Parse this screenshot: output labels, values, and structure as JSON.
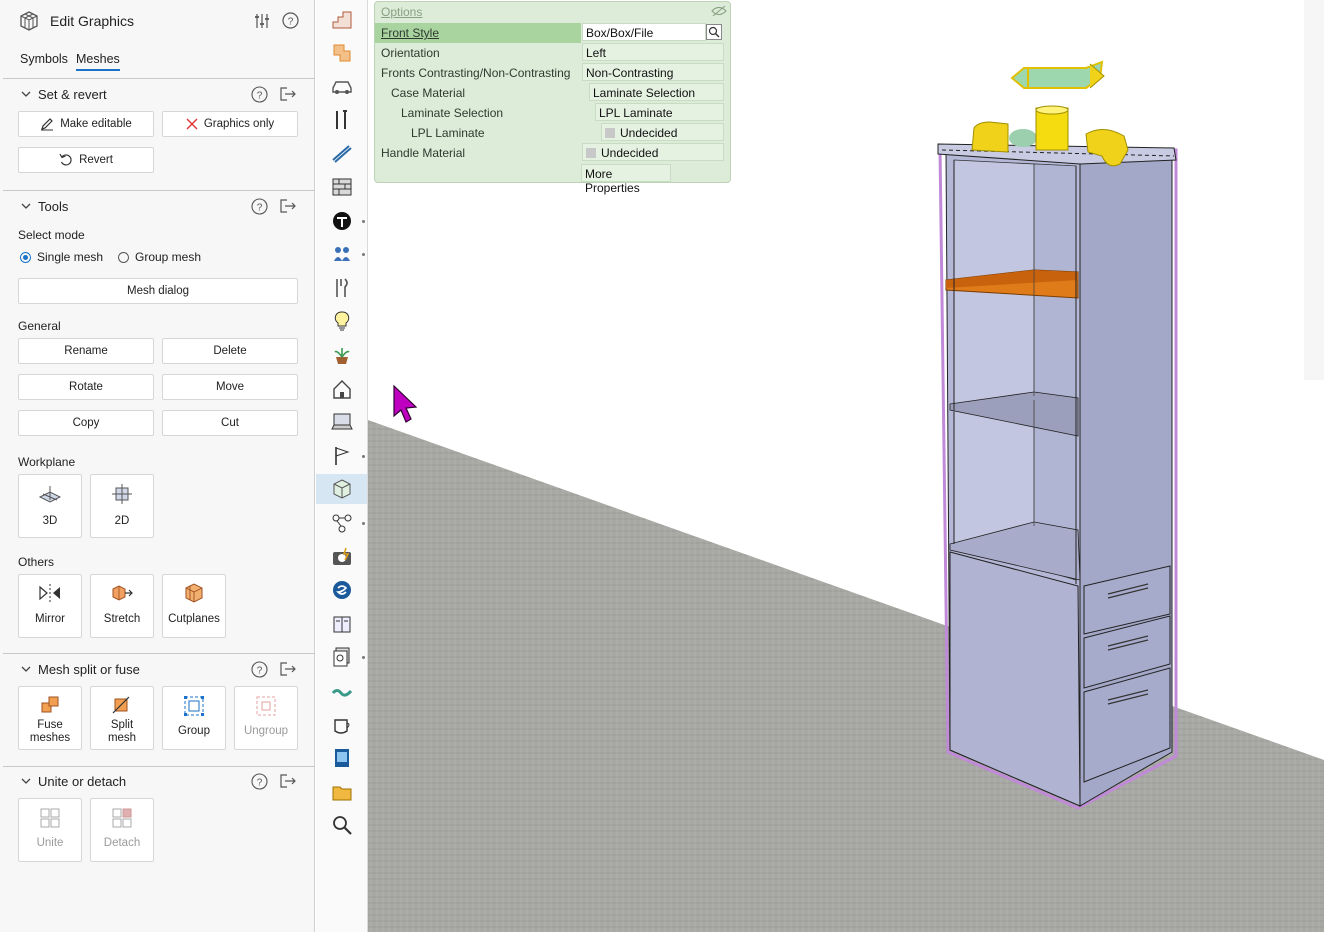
{
  "app": {
    "title": "Edit Graphics"
  },
  "tabs": [
    {
      "label": "Symbols"
    },
    {
      "label": "Meshes"
    }
  ],
  "sections": {
    "set_revert": {
      "title": "Set & revert",
      "make_editable": "Make editable",
      "graphics_only": "Graphics only",
      "revert": "Revert"
    },
    "tools": {
      "title": "Tools",
      "select_mode": "Select mode",
      "single_mesh": "Single mesh",
      "group_mesh": "Group mesh",
      "mesh_dialog": "Mesh dialog",
      "general": "General",
      "rename": "Rename",
      "delete": "Delete",
      "rotate": "Rotate",
      "move": "Move",
      "copy": "Copy",
      "cut": "Cut",
      "workplane": "Workplane",
      "wp_3d": "3D",
      "wp_2d": "2D",
      "others": "Others",
      "mirror": "Mirror",
      "stretch": "Stretch",
      "cutplanes": "Cutplanes"
    },
    "split_fuse": {
      "title": "Mesh split or fuse",
      "fuse1": "Fuse",
      "fuse2": "meshes",
      "split1": "Split",
      "split2": "mesh",
      "group": "Group",
      "ungroup": "Ungroup"
    },
    "unite_detach": {
      "title": "Unite or detach",
      "unite": "Unite",
      "detach": "Detach"
    }
  },
  "options": {
    "title": "Options",
    "rows": [
      {
        "key": "Front Style",
        "value": "Box/Box/File"
      },
      {
        "key": "Orientation",
        "value": "Left"
      },
      {
        "key": "Fronts Contrasting/Non-Contrasting",
        "value": "Non-Contrasting"
      },
      {
        "key": "Case Material",
        "value": "Laminate Selection"
      },
      {
        "key": "Laminate Selection",
        "value": "LPL Laminate"
      },
      {
        "key": "LPL Laminate",
        "value": "Undecided"
      },
      {
        "key": "Handle Material",
        "value": "Undecided"
      }
    ],
    "more": "More Properties"
  },
  "colors": {
    "accent": "#1a73c8",
    "options_bg": "#dcecd8",
    "selected_row": "#a9d4a0",
    "mesh": "#a9aed0",
    "shelf": "#e07b1a",
    "gizmo": "#f0d21a",
    "cursor": "#c000c0"
  },
  "toolbar_icons": [
    "stairs-icon",
    "wall-icon",
    "car-icon",
    "tools-icon",
    "ramp-icon",
    "brick-icon",
    "pen-nib-icon",
    "people-icon",
    "kitchen-tools-icon",
    "lightbulb-icon",
    "plant-icon",
    "home-icon",
    "computer-icon",
    "flag-icon",
    "mesh-cube-icon",
    "workflow-icon",
    "camera-icon",
    "sketchup-icon",
    "book-icon",
    "stack-icon",
    "dimension-icon",
    "coffee-icon",
    "tablet-icon",
    "folder-icon",
    "zoom-icon"
  ]
}
